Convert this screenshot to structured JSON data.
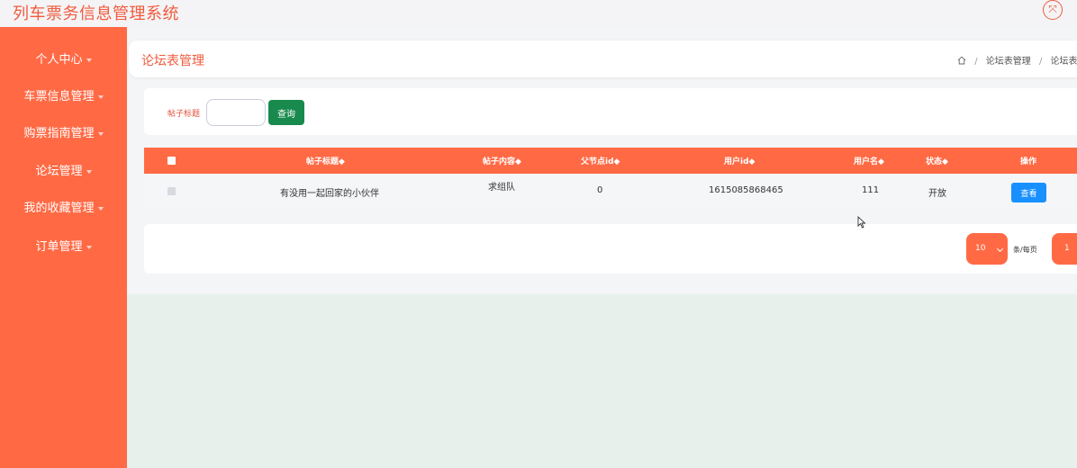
{
  "app": {
    "title": "列车票务信息管理系统"
  },
  "sidebar": {
    "items": [
      {
        "label": "个人中心"
      },
      {
        "label": "车票信息管理"
      },
      {
        "label": "购票指南管理"
      },
      {
        "label": "论坛管理"
      },
      {
        "label": "我的收藏管理"
      },
      {
        "label": "订单管理"
      }
    ]
  },
  "header": {
    "title": "论坛表管理",
    "breadcrumb": [
      "论坛表管理",
      "论坛表列"
    ]
  },
  "search": {
    "label": "帖子标题",
    "value": "",
    "button_label": "查询"
  },
  "table": {
    "columns": [
      "帖子标题◆",
      "帖子内容◆",
      "父节点id◆",
      "用户id◆",
      "用户名◆",
      "状态◆",
      "操作"
    ],
    "rows": [
      {
        "title": "有没用一起回家的小伙伴",
        "content": "求组队",
        "parent_id": "0",
        "user_id": "1615085868465",
        "username": "111",
        "status": "开放",
        "action": "查看"
      }
    ]
  },
  "pagination": {
    "page_size": "10",
    "per_page_label": "条/每页",
    "current_page": "1"
  },
  "colors": {
    "accent": "#ff6a45",
    "title_red": "#f05b3d",
    "search_green": "#188a4d",
    "view_blue": "#1890ff"
  }
}
